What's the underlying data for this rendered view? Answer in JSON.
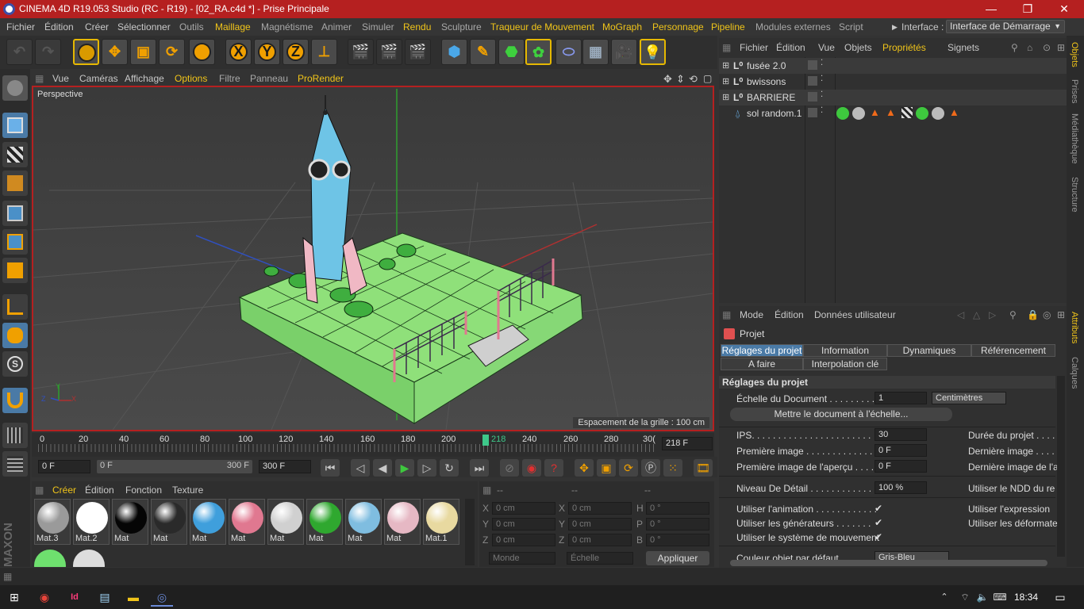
{
  "window": {
    "title": "CINEMA 4D R19.053 Studio (RC - R19) - [02_RA.c4d *] - Prise Principale",
    "minimize": "—",
    "maximize": "❐",
    "close": "✕"
  },
  "menubar": {
    "items": [
      "Fichier",
      "Édition",
      "Créer",
      "Sélectionner",
      "Outils",
      "Maillage",
      "Magnétisme",
      "Animer",
      "Simuler",
      "Rendu",
      "Sculpture",
      "Traqueur de Mouvement",
      "MoGraph",
      "Personnage",
      "Pipeline",
      "Modules externes",
      "Script"
    ],
    "interface_label": "Interface :",
    "interface_value": "Interface de Démarrage"
  },
  "toolbar": {
    "x_label": "X",
    "y_label": "Y",
    "z_label": "Z"
  },
  "viewport": {
    "menu": [
      "Vue",
      "Caméras",
      "Affichage",
      "Options",
      "Filtre",
      "Panneau",
      "ProRender"
    ],
    "label": "Perspective",
    "grid_spacing": "Espacement de la grille : 100 cm",
    "axis_x": "X",
    "axis_y": "Y",
    "axis_z": "Z"
  },
  "timeline": {
    "ticks": [
      "0",
      "20",
      "40",
      "60",
      "80",
      "100",
      "120",
      "140",
      "160",
      "180",
      "200",
      "220",
      "240",
      "260",
      "280",
      "30("
    ],
    "current": "218",
    "current_field": "218 F"
  },
  "transport": {
    "start": "0 F",
    "range_start": "0 F",
    "range_end": "300 F",
    "end": "300 F"
  },
  "materials": {
    "menu": [
      "Créer",
      "Édition",
      "Fonction",
      "Texture"
    ],
    "items": [
      {
        "name": "Mat.3",
        "color": "#9a9a9a"
      },
      {
        "name": "Mat.2",
        "color": "#ffffff"
      },
      {
        "name": "Mat",
        "color": "#050505"
      },
      {
        "name": "Mat",
        "color": "#2a2a2a"
      },
      {
        "name": "Mat",
        "color": "#3f9fdc"
      },
      {
        "name": "Mat",
        "color": "#e07890"
      },
      {
        "name": "Mat",
        "color": "#d0d0d0"
      },
      {
        "name": "Mat",
        "color": "#2fa82f"
      },
      {
        "name": "Mat",
        "color": "#7fbde0"
      },
      {
        "name": "Mat",
        "color": "#e6b8c4"
      },
      {
        "name": "Mat.1",
        "color": "#e8d9a0"
      }
    ]
  },
  "coords": {
    "headers": [
      "--",
      "--",
      "--"
    ],
    "rows": [
      {
        "a": "X",
        "av": "0 cm",
        "b": "X",
        "bv": "0 cm",
        "c": "H",
        "cv": "0 °"
      },
      {
        "a": "Y",
        "av": "0 cm",
        "b": "Y",
        "bv": "0 cm",
        "c": "P",
        "cv": "0 °"
      },
      {
        "a": "Z",
        "av": "0 cm",
        "b": "Z",
        "bv": "0 cm",
        "c": "B",
        "cv": "0 °"
      }
    ],
    "mode": "Monde",
    "scale": "Échelle",
    "apply": "Appliquer"
  },
  "objects": {
    "menu": [
      "Fichier",
      "Édition",
      "Vue",
      "Objets",
      "Propriétés",
      "Signets"
    ],
    "rows": [
      "fusée 2.0",
      "bwissons",
      "BARRIERE",
      "sol random.1"
    ]
  },
  "attributes": {
    "menu": [
      "Mode",
      "Édition",
      "Données utilisateur"
    ],
    "object": "Projet",
    "tabs": [
      "Réglages du projet",
      "Information",
      "Dynamiques",
      "Référencement",
      "A faire",
      "Interpolation clé"
    ],
    "section": "Réglages du projet",
    "doc_scale_label": "Échelle du Document . . . . . . . . .",
    "doc_scale_value": "1",
    "doc_scale_unit": "Centimètres",
    "scale_button": "Mettre le document à l'échelle...",
    "ips_label": "IPS. . . . . . . . . . . . . . . . . . . . . . .",
    "ips_value": "30",
    "duration_label": "Durée du projet  . . . .",
    "first_label": "Première image . . . . . . . . . . . . .",
    "first_value": "0 F",
    "last_label": "Dernière image  . . . .",
    "first_preview_label": "Première image de l'aperçu . . . . .",
    "first_preview_value": "0 F",
    "last_preview_label": "Dernière image de l'a",
    "lod_label": "Niveau De Détail . . . . . . . . . . . .",
    "lod_value": "100 %",
    "lod_right": "Utiliser le NDD du re",
    "anim_label": "Utiliser l'animation . . . . . . . . . . . .",
    "expr_label": "Utiliser l'expression",
    "gen_label": "Utiliser les générateurs  . . . . . . .",
    "deform_label": "Utiliser les déformate",
    "motion_label": "Utiliser le système de mouvement",
    "color_label": "Couleur objet par défaut. . . . . . .",
    "color_value": "Gris-Bleu",
    "check": "✔"
  },
  "rightstrip": [
    "Objets",
    "Prises",
    "Médiathèque",
    "Structure",
    "Attributs",
    "Calques"
  ],
  "taskbar": {
    "time": "18:34"
  }
}
